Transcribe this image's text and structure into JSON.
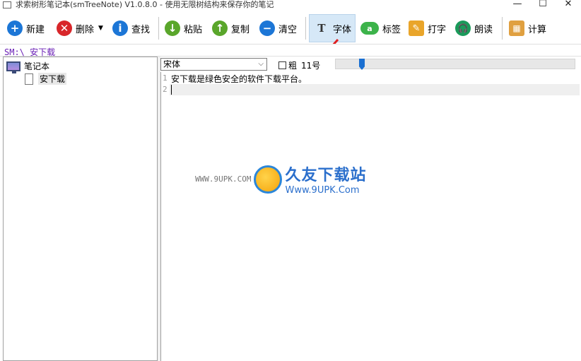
{
  "window": {
    "title": "求索树形笔记本(smTreeNote) V1.0.8.0 - 使用无限树结构来保存你的笔记",
    "min": "—",
    "max": "☐",
    "close": "✕"
  },
  "toolbar": {
    "new_label": "新建",
    "delete_label": "删除",
    "find_label": "查找",
    "paste_label": "粘贴",
    "copy_label": "复制",
    "clear_label": "清空",
    "font_label": "字体",
    "tag_label": "标签",
    "type_label": "打字",
    "read_label": "朗读",
    "calc_label": "计算"
  },
  "path": {
    "text": "SM:\\ 安下载"
  },
  "tree": {
    "root": "笔记本",
    "children": [
      "安下载"
    ]
  },
  "fontbar": {
    "font_name": "宋体",
    "bold_label": "粗",
    "size_label": "11号",
    "size_slider_fraction": 0.1
  },
  "editor": {
    "line_numbers": [
      "1",
      "2"
    ],
    "lines": [
      "安下载是绿色安全的软件下载平台。",
      ""
    ]
  },
  "watermark": {
    "small": "WWW.9UPK.COM",
    "big": "久友下载站",
    "url": "Www.9UPK.Com"
  },
  "colors": {
    "accent": "#1a6fd1",
    "path_text": "#6a1fb5",
    "active_button": "#d6e8f7"
  }
}
